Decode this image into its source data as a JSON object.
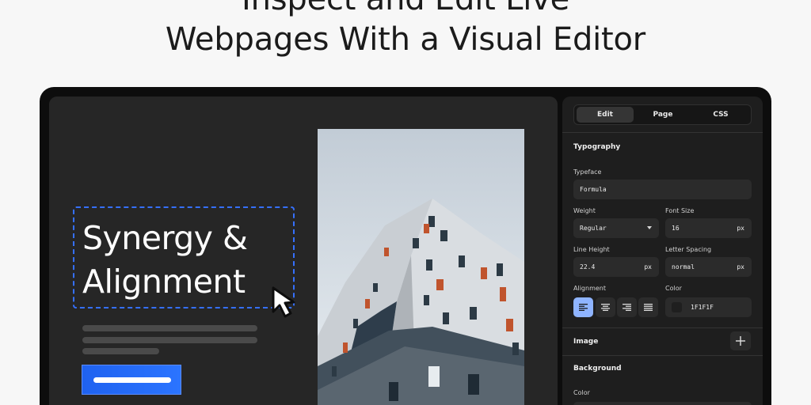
{
  "headline": {
    "line1": "Inspect and Edit Live",
    "line2": "Webpages With a Visual Editor"
  },
  "canvas": {
    "hero_title_line1": "Synergy &",
    "hero_title_line2": "Alignment"
  },
  "panel": {
    "tabs": [
      {
        "label": "Edit",
        "active": true
      },
      {
        "label": "Page",
        "active": false
      },
      {
        "label": "CSS",
        "active": false
      }
    ],
    "typography": {
      "heading": "Typography",
      "typeface": {
        "label": "Typeface",
        "value": "Formula"
      },
      "weight": {
        "label": "Weight",
        "value": "Regular"
      },
      "font_size": {
        "label": "Font Size",
        "value": "16",
        "unit": "px"
      },
      "line_height": {
        "label": "Line Height",
        "value": "22.4",
        "unit": "px"
      },
      "letter_spacing": {
        "label": "Letter Spacing",
        "value": "normal",
        "unit": "px"
      },
      "alignment": {
        "label": "Alignment",
        "options": [
          "align-left",
          "align-center",
          "align-right",
          "align-justify"
        ],
        "selected": "align-left"
      },
      "color": {
        "label": "Color",
        "value": "1F1F1F",
        "swatch": "#1F1F1F"
      }
    },
    "image": {
      "heading": "Image"
    },
    "background": {
      "heading": "Background",
      "color_label": "Color"
    }
  },
  "colors": {
    "accent": "#2B74FF",
    "selection": "#3570FF",
    "alignment_active": "#8FB4FF"
  }
}
